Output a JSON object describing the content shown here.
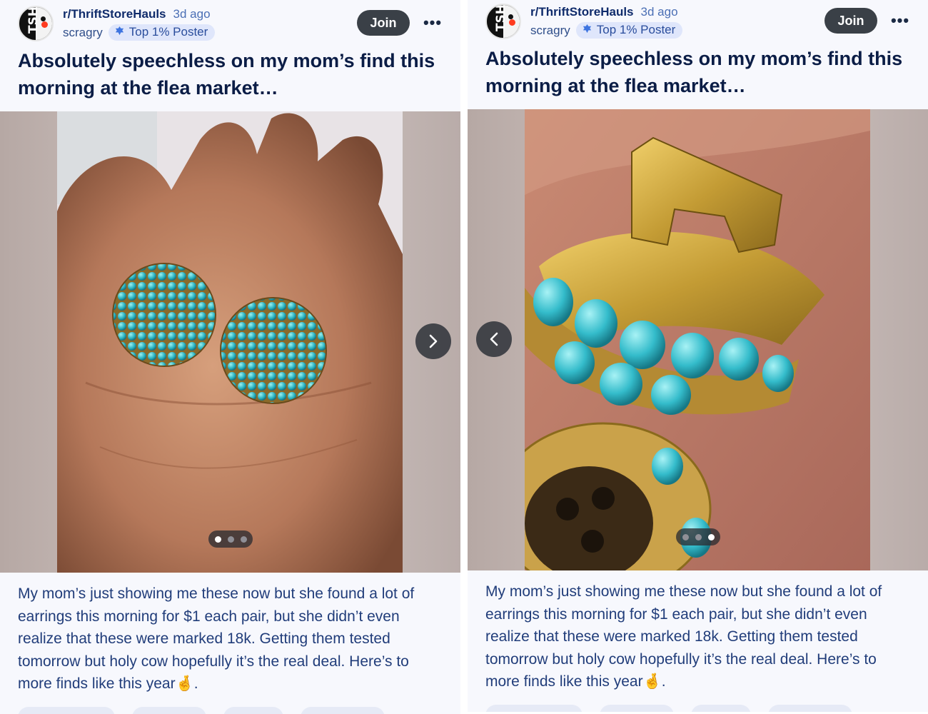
{
  "post": {
    "subreddit": "r/ThriftStoreHauls",
    "time": "3d ago",
    "username": "scragry",
    "badge": "Top 1% Poster",
    "join_label": "Join",
    "more_label": "•••",
    "title": "Absolutely speechless on my mom’s find this morning at the flea market…",
    "body": "My mom’s just showing me these now but she found a lot of earrings this morning for $1 each pair, but she didn’t even realize that these were marked 18k. Getting them tested tomorrow but holy cow hopefully it’s the real deal. Here’s to more finds like this year🤞.",
    "avatar_letters": "TSH"
  },
  "carousel": {
    "total": 3,
    "left_panel_active": 1,
    "right_panel_active": 3,
    "image_1": "turquoise-dome-earrings-in-palm",
    "image_2": "gold-clasp-closeup"
  },
  "colors": {
    "join_bg": "#3a4047",
    "title": "#0b1d46",
    "body": "#213d7a",
    "badge_bg": "#dfe6fb",
    "subreddit": "#0f2b6b",
    "time": "#4b6fb5"
  }
}
